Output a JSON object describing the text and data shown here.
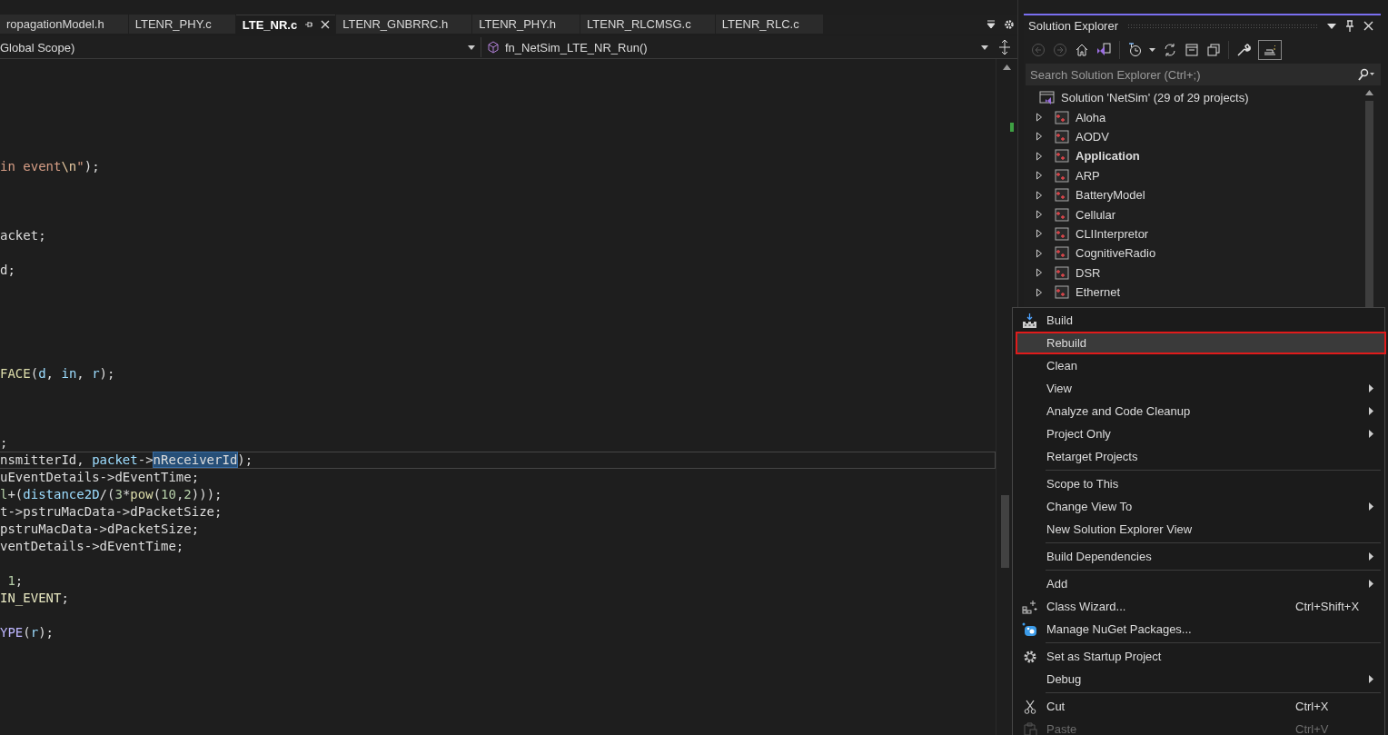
{
  "editor_tabs": [
    {
      "label": "ropagationModel.h",
      "selected": false
    },
    {
      "label": "LTENR_PHY.c",
      "selected": false
    },
    {
      "label": "LTE_NR.c",
      "selected": true
    },
    {
      "label": "LTENR_GNBRRC.h",
      "selected": false
    },
    {
      "label": "LTENR_PHY.h",
      "selected": false
    },
    {
      "label": "LTENR_RLCMSG.c",
      "selected": false
    },
    {
      "label": "LTENR_RLC.c",
      "selected": false
    }
  ],
  "navigation_bar": {
    "scope": "Global Scope)",
    "member": "fn_NetSim_LTE_NR_Run()"
  },
  "code_lines": [
    {
      "kind": "blank"
    },
    {
      "kind": "blank"
    },
    {
      "kind": "blank"
    },
    {
      "kind": "blank"
    },
    {
      "kind": "blank"
    },
    {
      "kind": "code",
      "current": false,
      "tokens": [
        {
          "text": "in event",
          "kind": "string"
        },
        {
          "text": "\\n",
          "kind": "escape"
        },
        {
          "text": "\"",
          "kind": "string"
        },
        {
          "text": ");",
          "kind": "plain"
        }
      ]
    },
    {
      "kind": "blank"
    },
    {
      "kind": "blank"
    },
    {
      "kind": "blank"
    },
    {
      "kind": "code",
      "current": false,
      "tokens": [
        {
          "text": "acket;",
          "kind": "plain"
        }
      ]
    },
    {
      "kind": "blank"
    },
    {
      "kind": "code",
      "current": false,
      "tokens": [
        {
          "text": "d;",
          "kind": "plain"
        }
      ]
    },
    {
      "kind": "blank"
    },
    {
      "kind": "blank"
    },
    {
      "kind": "blank"
    },
    {
      "kind": "blank"
    },
    {
      "kind": "blank"
    },
    {
      "kind": "code",
      "current": false,
      "tokens": [
        {
          "text": "FACE",
          "kind": "function"
        },
        {
          "text": "(",
          "kind": "plain"
        },
        {
          "text": "d",
          "kind": "variable"
        },
        {
          "text": ", ",
          "kind": "plain"
        },
        {
          "text": "in",
          "kind": "variable"
        },
        {
          "text": ", ",
          "kind": "plain"
        },
        {
          "text": "r",
          "kind": "variable"
        },
        {
          "text": ");",
          "kind": "plain"
        }
      ]
    },
    {
      "kind": "blank"
    },
    {
      "kind": "blank"
    },
    {
      "kind": "blank"
    },
    {
      "kind": "code",
      "current": false,
      "tokens": [
        {
          "text": ";",
          "kind": "plain"
        }
      ]
    },
    {
      "kind": "code",
      "current": true,
      "tokens": [
        {
          "text": "nsmitterId",
          "kind": "plain"
        },
        {
          "text": ", ",
          "kind": "plain"
        },
        {
          "text": "packet",
          "kind": "variable"
        },
        {
          "text": "->",
          "kind": "plain"
        },
        {
          "text": "nReceiverId",
          "kind": "selected"
        },
        {
          "text": ");",
          "kind": "plain"
        }
      ]
    },
    {
      "kind": "code",
      "current": false,
      "tokens": [
        {
          "text": "uEventDetails->dEventTime;",
          "kind": "plain"
        }
      ]
    },
    {
      "kind": "code",
      "current": false,
      "tokens": [
        {
          "text": "l",
          "kind": "number"
        },
        {
          "text": "+(",
          "kind": "plain"
        },
        {
          "text": "distance2D",
          "kind": "variable"
        },
        {
          "text": "/(",
          "kind": "plain"
        },
        {
          "text": "3",
          "kind": "number"
        },
        {
          "text": "*",
          "kind": "plain"
        },
        {
          "text": "pow",
          "kind": "function"
        },
        {
          "text": "(",
          "kind": "plain"
        },
        {
          "text": "10",
          "kind": "number"
        },
        {
          "text": ",",
          "kind": "plain"
        },
        {
          "text": "2",
          "kind": "number"
        },
        {
          "text": ")));",
          "kind": "plain"
        }
      ]
    },
    {
      "kind": "code",
      "current": false,
      "tokens": [
        {
          "text": "t->pstruMacData->dPacketSize;",
          "kind": "plain"
        }
      ]
    },
    {
      "kind": "code",
      "current": false,
      "tokens": [
        {
          "text": "pstruMacData->dPacketSize;",
          "kind": "plain"
        }
      ]
    },
    {
      "kind": "code",
      "current": false,
      "tokens": [
        {
          "text": "ventDetails->dEventTime;",
          "kind": "plain"
        }
      ]
    },
    {
      "kind": "blank"
    },
    {
      "kind": "code",
      "current": false,
      "tokens": [
        {
          "text": " 1",
          "kind": "number"
        },
        {
          "text": ";",
          "kind": "plain"
        }
      ]
    },
    {
      "kind": "code",
      "current": false,
      "tokens": [
        {
          "text": "IN_EVENT",
          "kind": "constant"
        },
        {
          "text": ";",
          "kind": "plain"
        }
      ]
    },
    {
      "kind": "blank"
    },
    {
      "kind": "code",
      "current": false,
      "tokens": [
        {
          "text": "YPE",
          "kind": "macro"
        },
        {
          "text": "(",
          "kind": "plain"
        },
        {
          "text": "r",
          "kind": "variable"
        },
        {
          "text": ");",
          "kind": "plain"
        }
      ]
    }
  ],
  "solution_explorer": {
    "title": "Solution Explorer",
    "search": {
      "placeholder": "Search Solution Explorer (Ctrl+;)"
    },
    "solution": "Solution 'NetSim' (29 of 29 projects)",
    "projects": [
      {
        "name": "Aloha",
        "expanded": false,
        "startup": false
      },
      {
        "name": "AODV",
        "expanded": false,
        "startup": false
      },
      {
        "name": "Application",
        "expanded": false,
        "startup": true
      },
      {
        "name": "ARP",
        "expanded": false,
        "startup": false
      },
      {
        "name": "BatteryModel",
        "expanded": false,
        "startup": false
      },
      {
        "name": "Cellular",
        "expanded": false,
        "startup": false
      },
      {
        "name": "CLIInterpretor",
        "expanded": false,
        "startup": false
      },
      {
        "name": "CognitiveRadio",
        "expanded": false,
        "startup": false
      },
      {
        "name": "DSR",
        "expanded": false,
        "startup": false
      },
      {
        "name": "Ethernet",
        "expanded": false,
        "startup": false
      }
    ]
  },
  "context_menu": {
    "groups": [
      [
        {
          "label": "Build",
          "submenu": false,
          "selected": false,
          "disabled": false
        },
        {
          "label": "Rebuild",
          "submenu": false,
          "selected": true,
          "disabled": false
        },
        {
          "label": "Clean",
          "submenu": false,
          "selected": false,
          "disabled": false
        },
        {
          "label": "View",
          "submenu": true,
          "selected": false,
          "disabled": false
        },
        {
          "label": "Analyze and Code Cleanup",
          "submenu": true,
          "selected": false,
          "disabled": false
        },
        {
          "label": "Project Only",
          "submenu": true,
          "selected": false,
          "disabled": false
        },
        {
          "label": "Retarget Projects",
          "submenu": false,
          "selected": false,
          "disabled": false
        }
      ],
      [
        {
          "label": "Scope to This",
          "submenu": false,
          "selected": false,
          "disabled": false
        },
        {
          "label": "Change View To",
          "submenu": true,
          "selected": false,
          "disabled": false
        },
        {
          "label": "New Solution Explorer View",
          "submenu": false,
          "selected": false,
          "disabled": false
        }
      ],
      [
        {
          "label": "Build Dependencies",
          "submenu": true,
          "selected": false,
          "disabled": false
        }
      ],
      [
        {
          "label": "Add",
          "submenu": true,
          "selected": false,
          "disabled": false
        },
        {
          "label": "Class Wizard...",
          "shortcut": "Ctrl+Shift+X",
          "submenu": false,
          "selected": false,
          "disabled": false
        },
        {
          "label": "Manage NuGet Packages...",
          "submenu": false,
          "selected": false,
          "disabled": false
        }
      ],
      [
        {
          "label": "Set as Startup Project",
          "submenu": false,
          "selected": false,
          "disabled": false
        },
        {
          "label": "Debug",
          "submenu": true,
          "selected": false,
          "disabled": false
        }
      ],
      [
        {
          "label": "Cut",
          "shortcut": "Ctrl+X",
          "submenu": false,
          "selected": false,
          "disabled": false
        },
        {
          "label": "Paste",
          "shortcut": "Ctrl+V",
          "submenu": false,
          "selected": false,
          "disabled": true
        }
      ]
    ]
  }
}
